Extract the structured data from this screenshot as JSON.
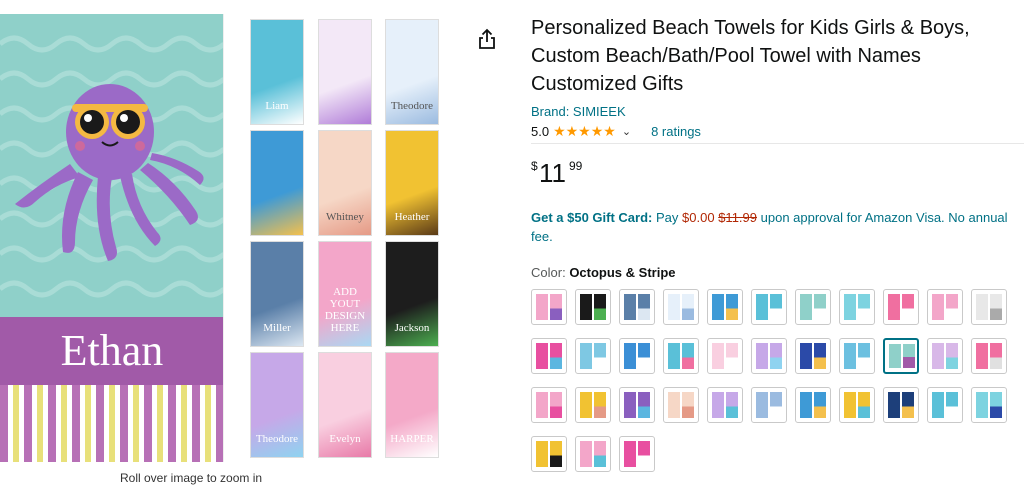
{
  "main_image": {
    "name_text": "Ethan",
    "zoom_hint": "Roll over image to zoom in"
  },
  "thumbnails": [
    {
      "label": "Liam",
      "bg": "#5ac0d8",
      "accent": "#ffffff",
      "label_dark": false
    },
    {
      "label": "",
      "bg": "#f3e8f7",
      "accent": "#b07cd8",
      "label_dark": false
    },
    {
      "label": "Theodore",
      "bg": "#e6f0fa",
      "accent": "#9bbbe0",
      "label_dark": true
    },
    {
      "label": "",
      "bg": "#3e9ad6",
      "accent": "#f4c04d",
      "label_dark": false
    },
    {
      "label": "Whitney",
      "bg": "#f6d7c6",
      "accent": "#e59a86",
      "label_dark": true
    },
    {
      "label": "Heather",
      "bg": "#f1c232",
      "accent": "#5a3a17",
      "label_dark": false
    },
    {
      "label": "Miller",
      "bg": "#5a7fa8",
      "accent": "#dce7f2",
      "label_dark": false
    },
    {
      "label": "ADD YOUT DESIGN HERE",
      "bg": "#f3a6c9",
      "accent": "#a9d8f3",
      "label_dark": false
    },
    {
      "label": "Jackson",
      "bg": "#1d1d1d",
      "accent": "#4caf50",
      "label_dark": false
    },
    {
      "label": "Theodore",
      "bg": "#c6a8e8",
      "accent": "#8fd3f0",
      "label_dark": false
    },
    {
      "label": "Evelyn",
      "bg": "#f9cfe0",
      "accent": "#e87aa8",
      "label_dark": false
    },
    {
      "label": "HARPER",
      "bg": "#f4a9c8",
      "accent": "#ffffff",
      "label_dark": false
    }
  ],
  "product": {
    "title": "Personalized Beach Towels for Kids Girls & Boys, Custom Beach/Bath/Pool Towel with Names Customized Gifts",
    "brand": "Brand: SIMIEEK",
    "rating_value": "5.0",
    "stars": "★★★★★",
    "ratings_count": "8 ratings",
    "price_symbol": "$",
    "price_whole": "11",
    "price_fraction": "99",
    "gift_bold": "Get a $50 Gift Card:",
    "gift_pay": "Pay",
    "gift_price": "$0.00",
    "gift_strike": "$11.99",
    "gift_rest": "upon approval for Amazon Visa. No annual fee.",
    "color_label": "Color:",
    "color_value": "Octopus & Stripe"
  },
  "swatches": [
    [
      "#f3a6c9",
      "#8a5fbf"
    ],
    [
      "#1a1a1a",
      "#4caf50"
    ],
    [
      "#5a7fa8",
      "#dce7f2"
    ],
    [
      "#e6f0fa",
      "#9bbbe0"
    ],
    [
      "#3e9ad6",
      "#f4c04d"
    ],
    [
      "#5ac0d8",
      "#ffffff"
    ],
    [
      "#8fd0c9",
      "#ffffff"
    ],
    [
      "#7dd3e0",
      "#ffffff"
    ],
    [
      "#f06fa0",
      "#ffffff"
    ],
    [
      "#f3a6c9",
      "#ffffff"
    ],
    [
      "#e8e8e8",
      "#aaaaaa"
    ],
    [
      "#e84fa0",
      "#5bb6e0"
    ],
    [
      "#7ec8e3",
      "#ffffff"
    ],
    [
      "#3b8fd6",
      "#ffffff"
    ],
    [
      "#5ac0d8",
      "#f06fa0"
    ],
    [
      "#f9cfe0",
      "#ffffff"
    ],
    [
      "#c6a8e8",
      "#8fd3f0"
    ],
    [
      "#2b4aa8",
      "#f4c04d"
    ],
    [
      "#6cc0e0",
      "#ffffff"
    ],
    [
      "#8fd0c9",
      "#a15aa8"
    ],
    [
      "#d8b8e8",
      "#7dd3e0"
    ],
    [
      "#f06fa0",
      "#e0e0e0"
    ],
    [
      "#f3a6c9",
      "#e84fa0"
    ],
    [
      "#f1c232",
      "#e59a86"
    ],
    [
      "#8a5fbf",
      "#5bb6e0"
    ],
    [
      "#f6d7c6",
      "#e59a86"
    ],
    [
      "#c6a8e8",
      "#5ac0d8"
    ],
    [
      "#9bbbe0",
      "#ffffff"
    ],
    [
      "#3e9ad6",
      "#f4c04d"
    ],
    [
      "#f1c232",
      "#5ac0d8"
    ],
    [
      "#1d3f7a",
      "#f4c04d"
    ],
    [
      "#5ac0d8",
      "#ffffff"
    ],
    [
      "#7dd3e0",
      "#2b4aa8"
    ],
    [
      "#f1c232",
      "#1a1a1a"
    ],
    [
      "#f3a6c9",
      "#5ac0d8"
    ],
    [
      "#e84fa0",
      "#ffffff"
    ]
  ],
  "selected_swatch": 19
}
